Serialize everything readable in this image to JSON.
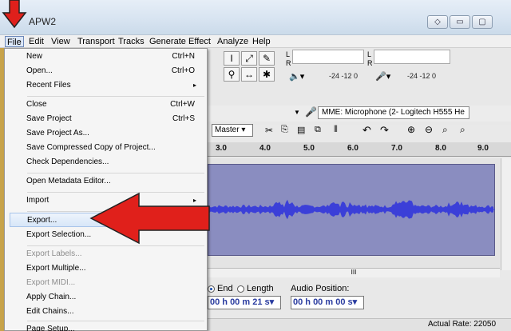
{
  "window": {
    "title": "APW2"
  },
  "menubar": [
    {
      "label": "File",
      "active": true
    },
    {
      "label": "Edit"
    },
    {
      "label": "View"
    },
    {
      "label": "Transport"
    },
    {
      "label": "Tracks"
    },
    {
      "label": "Generate"
    },
    {
      "label": "Effect"
    },
    {
      "label": "Analyze"
    },
    {
      "label": "Help"
    }
  ],
  "file_menu": {
    "items": [
      {
        "label": "New",
        "shortcut": "Ctrl+N"
      },
      {
        "label": "Open...",
        "shortcut": "Ctrl+O"
      },
      {
        "label": "Recent Files",
        "submenu": "▸"
      },
      {
        "label": "Close",
        "shortcut": "Ctrl+W"
      },
      {
        "label": "Save Project",
        "shortcut": "Ctrl+S"
      },
      {
        "label": "Save Project As..."
      },
      {
        "label": "Save Compressed Copy of Project..."
      },
      {
        "label": "Check Dependencies..."
      },
      {
        "label": "Open Metadata Editor..."
      },
      {
        "label": "Import",
        "submenu": "▸"
      },
      {
        "label": "Export...",
        "hover": true
      },
      {
        "label": "Export Selection..."
      },
      {
        "label": "Export Labels...",
        "disabled": true
      },
      {
        "label": "Export Multiple..."
      },
      {
        "label": "Export MIDI...",
        "disabled": true
      },
      {
        "label": "Apply Chain..."
      },
      {
        "label": "Edit Chains..."
      },
      {
        "label": "Page Setup..."
      }
    ]
  },
  "meters": {
    "left_label": "L",
    "right_label": "R",
    "scale_rec": "-24  -12  0",
    "scale_play": "-24  -12  0"
  },
  "device": {
    "input": "MME: Microphone (2- Logitech H555 He"
  },
  "mixer": {
    "master": "Master"
  },
  "ruler": {
    "ticks": [
      "3.0",
      "4.0",
      "5.0",
      "6.0",
      "7.0",
      "8.0",
      "9.0"
    ]
  },
  "hscroll_grip": "III",
  "selection": {
    "end_label": "End",
    "length_label": "Length",
    "audio_position_label": "Audio Position:",
    "end_time": "00 h 00 m 21 s",
    "audio_position": "00 h 00 m 00 s"
  },
  "status": {
    "actual_rate": "Actual Rate: 22050"
  },
  "colors": {
    "annotation_red": "#e0201b",
    "wave_fill": "#3b3fd8",
    "track_bg": "#8a8dc0"
  }
}
